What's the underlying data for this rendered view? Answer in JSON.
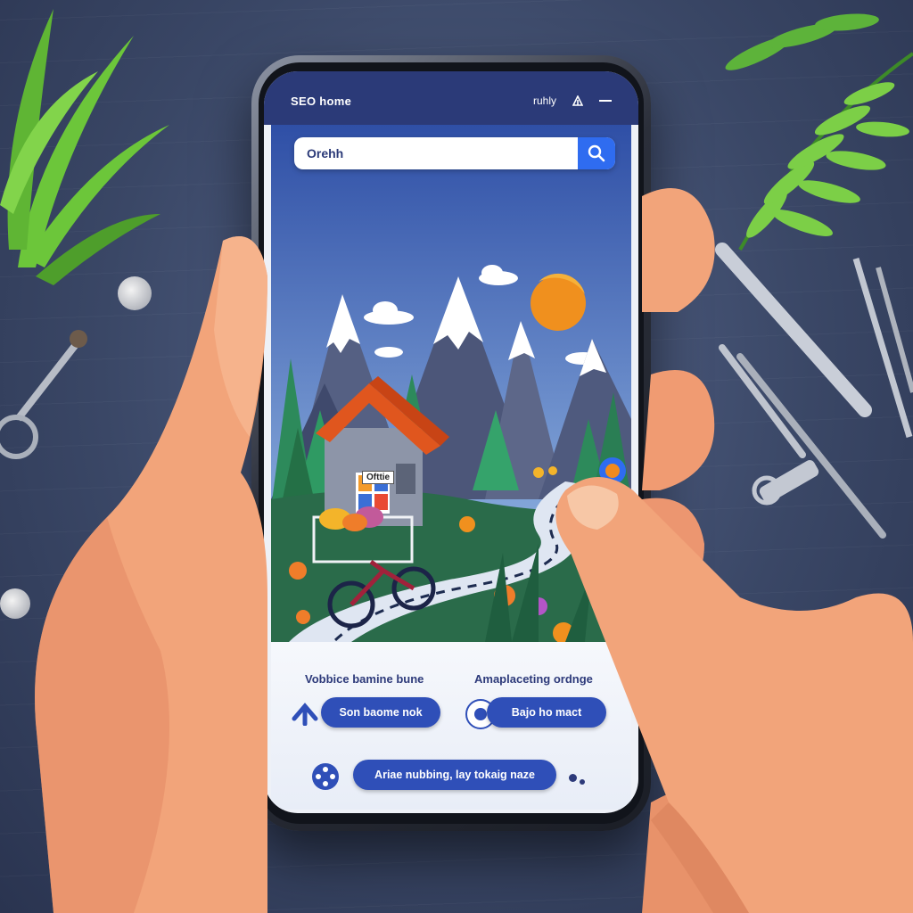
{
  "status_bar": {
    "title": "SEO home",
    "right_text": "ruhly",
    "signal_icon": "signal-icon",
    "menu_icon": "dash-icon"
  },
  "search": {
    "value": "Orehh",
    "button_icon": "search-icon"
  },
  "illustration": {
    "house_sign": "Ofttie"
  },
  "panel": {
    "left_label": "Vobbice bamine bune",
    "right_label": "Amaplaceting ordnge",
    "left_button": "Son baome nok",
    "right_button": "Bajo ho mact",
    "bottom_button": "Ariae nubbing, lay tokaig naze",
    "left_icon": "arrow-up-icon",
    "right_icon": "circle-icon",
    "bottom_icon": "gamepad-icon"
  },
  "colors": {
    "accent": "#2f4fb8",
    "status_bar": "#2b3a78",
    "search_button": "#2f6cf0",
    "sun": "#f0901e",
    "map_pin": "#f28a1e"
  }
}
